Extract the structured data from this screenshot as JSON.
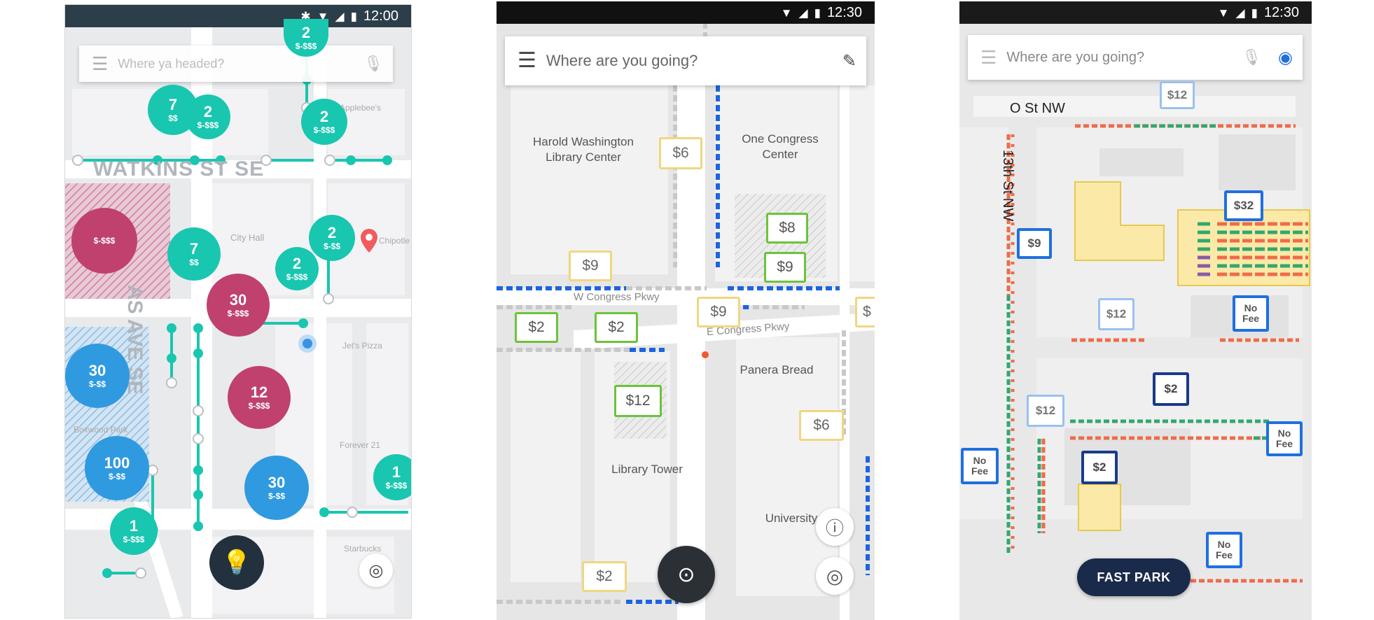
{
  "screens": [
    {
      "status": {
        "time": "12:00"
      },
      "search": {
        "placeholder": "Where ya headed?"
      },
      "streets": {
        "watkins": "WATKINS ST SE",
        "avenue": "AS AVE SE"
      },
      "places": [
        "Applebee's",
        "City Hall",
        "Chipotle",
        "Jet's Pizza",
        "Starbucks",
        "Forever 21",
        "Boxwood Park"
      ],
      "bubbles": [
        {
          "count": "7",
          "price": "$$"
        },
        {
          "count": "2",
          "price": "$-$$$"
        },
        {
          "count": "2",
          "price": "$-$$$"
        },
        {
          "count": "7",
          "price": "$$"
        },
        {
          "count": "2",
          "price": "$-$$"
        },
        {
          "count": "2",
          "price": "$-$$$"
        },
        {
          "count": "30",
          "price": "$-$$$"
        },
        {
          "count": "12",
          "price": "$-$$$"
        },
        {
          "count": "30",
          "price": "$-$$"
        },
        {
          "count": "100",
          "price": "$-$$"
        },
        {
          "count": "30",
          "price": "$-$$"
        },
        {
          "count": "1",
          "price": "$-$$$"
        },
        {
          "count": "1",
          "price": "$-$$$"
        },
        {
          "count": "",
          "price": "$-$$$"
        },
        {
          "count": "2",
          "price": "$-$$$"
        }
      ]
    },
    {
      "status": {
        "time": "12:30"
      },
      "search": {
        "placeholder": "Where are you going?"
      },
      "places": [
        "Harold Washington Library Center",
        "One Congress Center",
        "Panera Bread",
        "Library Tower",
        "University"
      ],
      "streets": {
        "w_congress": "W Congress Pkwy",
        "e_congress": "E Congress Pkwy"
      },
      "prices": [
        "$6",
        "$8",
        "$9",
        "$9",
        "$9",
        "$2",
        "$2",
        "$12",
        "$6",
        "$2",
        "$"
      ]
    },
    {
      "status": {
        "time": "12:30"
      },
      "search": {
        "placeholder": "Where are you going?"
      },
      "streets": {
        "o_st": "O St NW",
        "thirteenth": "13th St NW"
      },
      "tags": [
        "$12",
        "$32",
        "$9",
        "$12",
        "No Fee",
        "$2",
        "$12",
        "No Fee",
        "No Fee",
        "$2",
        "No Fee"
      ],
      "fast_park": "FAST PARK"
    }
  ],
  "colors": {
    "teal": "#19c6b0",
    "magenta": "#c0416e",
    "blue": "#2f9ae0",
    "dark": "#23303e",
    "navy": "#1a2a4a",
    "yellow": "#f0d680",
    "green": "#6cc33a",
    "pblue": "#1f6fe0"
  }
}
